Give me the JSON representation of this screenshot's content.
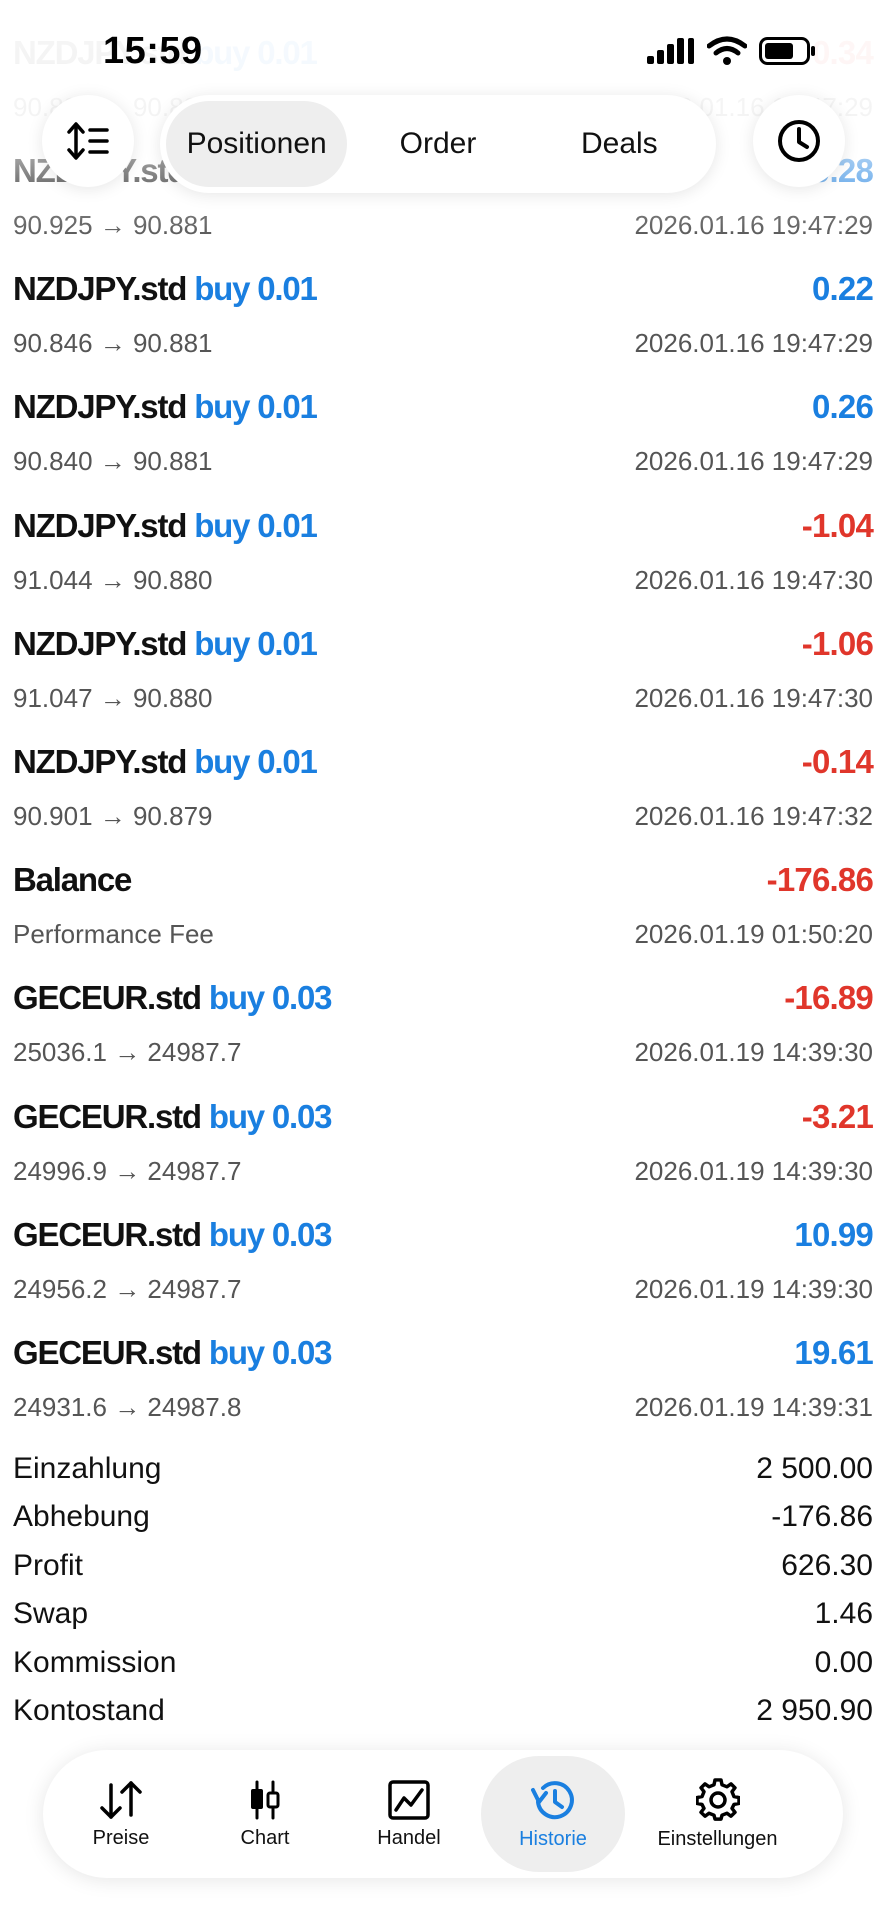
{
  "status_bar": {
    "time": "15:59"
  },
  "header": {
    "tabs": [
      {
        "label": "Positionen"
      },
      {
        "label": "Order"
      },
      {
        "label": "Deals"
      }
    ]
  },
  "partial_row": {
    "symbol": "NZDJPY.std",
    "direction": "buy 0.01",
    "value": "0.34",
    "prices": "90.884 → 90.881",
    "time": "2026.01.16 19:47:29"
  },
  "deals": [
    {
      "symbol": "NZDJPY.std",
      "direction": "buy 0.01",
      "value": "0.28",
      "sign": "pos",
      "prices": "90.925 → 90.881",
      "time": "2026.01.16 19:47:29"
    },
    {
      "symbol": "NZDJPY.std",
      "direction": "buy 0.01",
      "value": "0.22",
      "sign": "pos",
      "prices": "90.846 → 90.881",
      "time": "2026.01.16 19:47:29"
    },
    {
      "symbol": "NZDJPY.std",
      "direction": "buy 0.01",
      "value": "0.26",
      "sign": "pos",
      "prices": "90.840 → 90.881",
      "time": "2026.01.16 19:47:29"
    },
    {
      "symbol": "NZDJPY.std",
      "direction": "buy 0.01",
      "value": "-1.04",
      "sign": "neg",
      "prices": "91.044 → 90.880",
      "time": "2026.01.16 19:47:30"
    },
    {
      "symbol": "NZDJPY.std",
      "direction": "buy 0.01",
      "value": "-1.06",
      "sign": "neg",
      "prices": "91.047 → 90.880",
      "time": "2026.01.16 19:47:30"
    },
    {
      "symbol": "NZDJPY.std",
      "direction": "buy 0.01",
      "value": "-0.14",
      "sign": "neg",
      "prices": "90.901 → 90.879",
      "time": "2026.01.16 19:47:32"
    },
    {
      "symbol": "Balance",
      "direction": "",
      "value": "-176.86",
      "sign": "neg",
      "prices": "Performance Fee",
      "time": "2026.01.19 01:50:20"
    },
    {
      "symbol": "GECEUR.std",
      "direction": "buy 0.03",
      "value": "-16.89",
      "sign": "neg",
      "prices": "25036.1 → 24987.7",
      "time": "2026.01.19 14:39:30"
    },
    {
      "symbol": "GECEUR.std",
      "direction": "buy 0.03",
      "value": "-3.21",
      "sign": "neg",
      "prices": "24996.9 → 24987.7",
      "time": "2026.01.19 14:39:30"
    },
    {
      "symbol": "GECEUR.std",
      "direction": "buy 0.03",
      "value": "10.99",
      "sign": "pos",
      "prices": "24956.2 → 24987.7",
      "time": "2026.01.19 14:39:30"
    },
    {
      "symbol": "GECEUR.std",
      "direction": "buy 0.03",
      "value": "19.61",
      "sign": "pos",
      "prices": "24931.6 → 24987.8",
      "time": "2026.01.19 14:39:31"
    }
  ],
  "summary": [
    {
      "label": "Einzahlung",
      "value": "2 500.00"
    },
    {
      "label": "Abhebung",
      "value": "-176.86"
    },
    {
      "label": "Profit",
      "value": "626.30"
    },
    {
      "label": "Swap",
      "value": "1.46"
    },
    {
      "label": "Kommission",
      "value": "0.00"
    },
    {
      "label": "Kontostand",
      "value": "2 950.90"
    }
  ],
  "bottom_nav": [
    {
      "label": "Preise",
      "icon": "arrows-updown-icon"
    },
    {
      "label": "Chart",
      "icon": "candlestick-icon"
    },
    {
      "label": "Handel",
      "icon": "trade-chart-icon"
    },
    {
      "label": "Historie",
      "icon": "history-clock-icon",
      "active": true
    },
    {
      "label": "Einstellungen",
      "icon": "gear-icon"
    }
  ],
  "colors": {
    "accent": "#1a7fe0",
    "negative": "#e0362b",
    "text": "#111111",
    "muted": "#555555"
  }
}
